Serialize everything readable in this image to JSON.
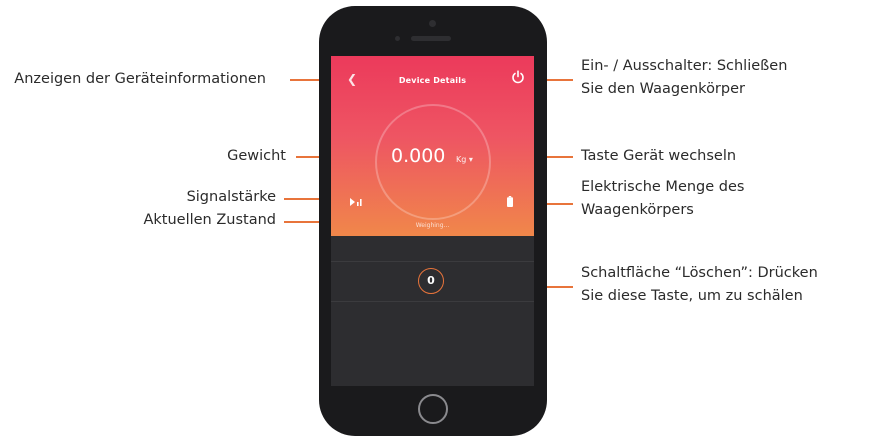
{
  "app": {
    "screen_title": "Device Details",
    "weight_value": "0.000",
    "weight_unit": "Kg",
    "status_text": "Weighing...",
    "clear_button_label": "0"
  },
  "callouts": {
    "device_info": "Anzeigen der Geräteinformationen",
    "power_switch_line1": "Ein- / Ausschalter: Schließen",
    "power_switch_line2": "Sie den Waagenkörper",
    "weight": "Gewicht",
    "switch_device": "Taste Gerät wechseln",
    "signal": "Signalstärke",
    "battery_line1": "Elektrische Menge des",
    "battery_line2": "Waagenkörpers",
    "current_state": "Aktuellen Zustand",
    "clear_line1": "Schaltfläche “Löschen”: Drücken",
    "clear_line2": "Sie diese Taste, um zu schälen"
  },
  "colors": {
    "accent": "#e8743b",
    "gradient_top": "#ec3a5b",
    "gradient_bottom": "#f0874a",
    "phone_body": "#1a1a1c",
    "screen_bg": "#2d2d30"
  },
  "icons": [
    "back-chevron-icon",
    "power-icon",
    "signal-icon",
    "battery-icon",
    "home-button"
  ]
}
